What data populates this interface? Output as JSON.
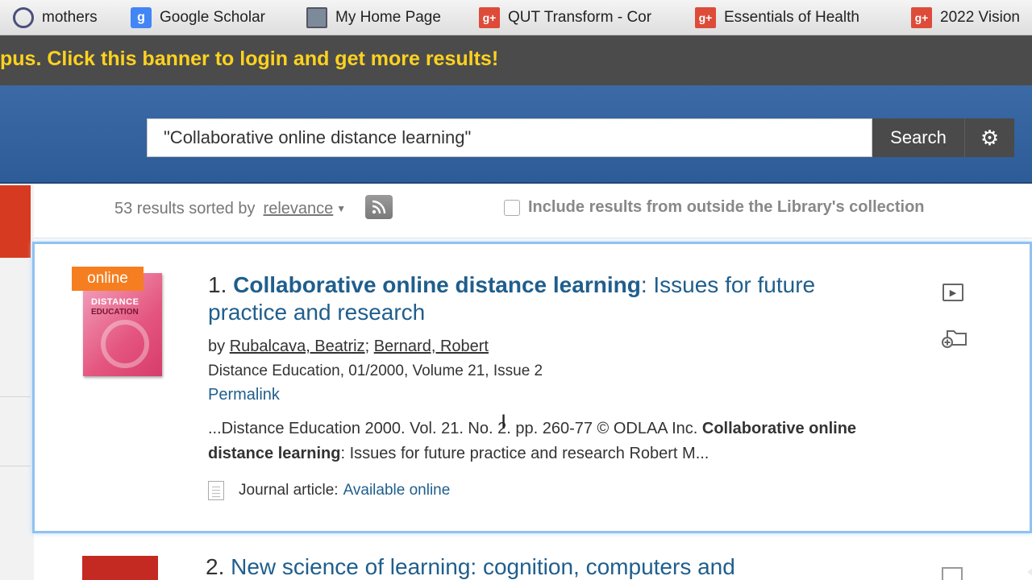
{
  "bookmarks": [
    {
      "label": "mothers",
      "icon": "circle-logo-icon"
    },
    {
      "label": "Google Scholar",
      "icon": "google-scholar-icon"
    },
    {
      "label": "My Home Page",
      "icon": "picture-icon"
    },
    {
      "label": "QUT Transform - Cor",
      "icon": "google-plus-icon"
    },
    {
      "label": "Essentials of Health",
      "icon": "google-plus-icon"
    },
    {
      "label": "2022 Vision",
      "icon": "google-plus-icon"
    }
  ],
  "banner": {
    "text": "pus. Click this banner to login and get more results!"
  },
  "search": {
    "query": "\"Collaborative online distance learning\"",
    "button_label": "Search",
    "settings_icon": "gear-icon"
  },
  "sort": {
    "prefix": "53 results sorted by",
    "option": "relevance"
  },
  "include": {
    "label": "Include results from outside the Library's collection",
    "checked": false
  },
  "result1": {
    "badge": "online",
    "cover_title": "DISTANCE",
    "cover_subtitle": "EDUCATION",
    "number": "1.",
    "title_bold": "Collaborative online distance learning",
    "title_rest": ": Issues for future practice and research",
    "by": "by",
    "author1": "Rubalcava, Beatriz",
    "sep": ";",
    "author2": "Bernard, Robert",
    "pubinfo": "Distance Education, 01/2000, Volume 21, Issue 2",
    "permalink": "Permalink",
    "snippet_pre": "...Distance Education 2000. Vol. 21. No. 2. pp. 260-77 © ODLAA Inc.",
    "snippet_bold": "Collaborative online distance learning",
    "snippet_post": ": Issues for future practice and research Robert M...",
    "type_label": "Journal article:",
    "availability": "Available online"
  },
  "result2": {
    "number": "2.",
    "title": "New science of learning: cognition, computers and"
  },
  "colors": {
    "accent": "#1f5e8d",
    "banner_text": "#ffd21f",
    "badge": "#f57f20",
    "header": "#3b6aa6"
  }
}
